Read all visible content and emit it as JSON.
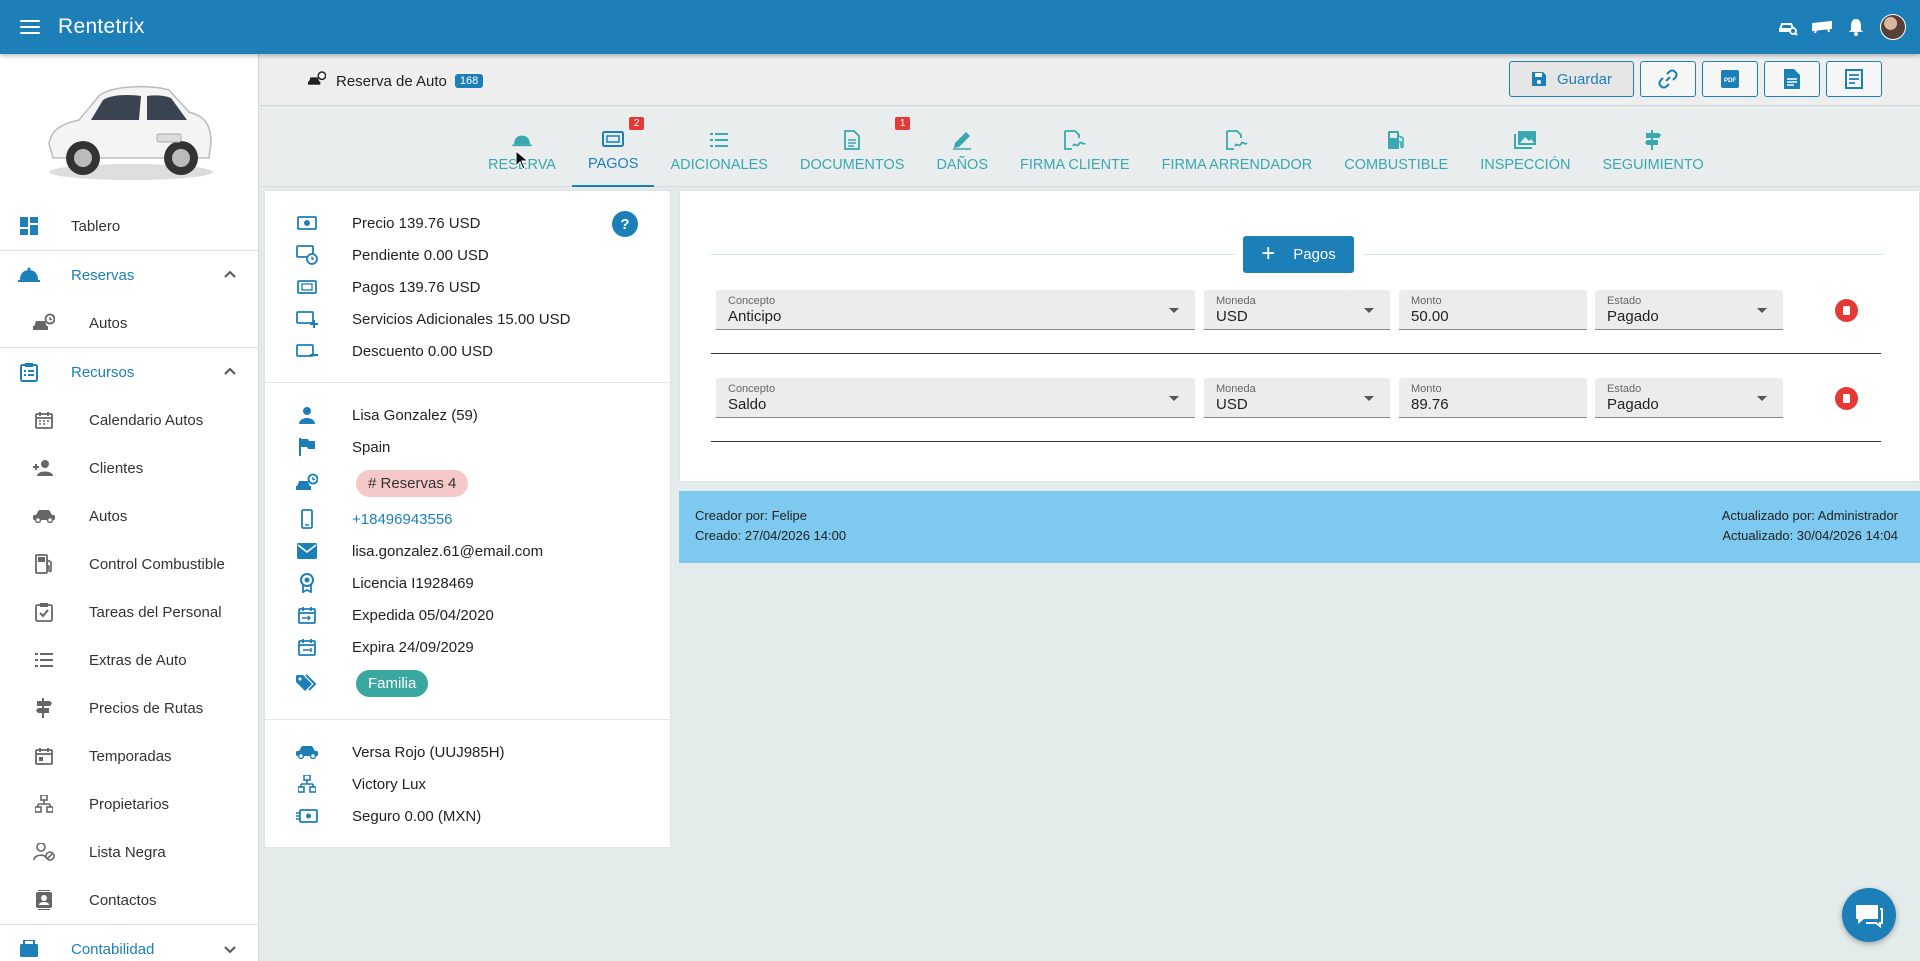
{
  "app": {
    "title": "Rentetrix"
  },
  "colors": {
    "primary": "#1d7fb8",
    "tab": "#3aa8b0",
    "badge": "#e53935",
    "audit_bar": "#7ec9ef",
    "tag_pink": "#f6c9c9",
    "tag_teal": "#3aa8a0"
  },
  "topbar": {
    "icons": [
      "car-search-icon",
      "plane-icon",
      "bell-icon",
      "user-avatar"
    ]
  },
  "sidebar": {
    "items": [
      {
        "label": "Tablero",
        "icon": "dashboard-icon"
      },
      {
        "label": "Reservas",
        "icon": "bell-service-icon",
        "group": true
      },
      {
        "label": "Autos",
        "icon": "car-clock-icon"
      },
      {
        "label": "Recursos",
        "icon": "clipboard-icon",
        "group": true
      },
      {
        "label": "Calendario Autos",
        "icon": "calendar-icon"
      },
      {
        "label": "Clientes",
        "icon": "add-user-icon"
      },
      {
        "label": "Autos",
        "icon": "car-icon"
      },
      {
        "label": "Control Combustible",
        "icon": "fuel-icon"
      },
      {
        "label": "Tareas del Personal",
        "icon": "clipboard-check-icon"
      },
      {
        "label": "Extras de Auto",
        "icon": "list-icon"
      },
      {
        "label": "Precios de Rutas",
        "icon": "signpost-icon"
      },
      {
        "label": "Temporadas",
        "icon": "calendar-icon"
      },
      {
        "label": "Propietarios",
        "icon": "sitemap-icon"
      },
      {
        "label": "Lista Negra",
        "icon": "user-block-icon"
      },
      {
        "label": "Contactos",
        "icon": "contacts-icon"
      },
      {
        "label": "Contabilidad",
        "icon": "accounting-icon",
        "group": true
      }
    ]
  },
  "header": {
    "title": "Reserva de Auto",
    "reservation_number": "168",
    "save_label": "Guardar"
  },
  "tabs": [
    {
      "label": "RESERVA",
      "icon": "bell-service-icon"
    },
    {
      "label": "PAGOS",
      "icon": "money-icon",
      "count": "2",
      "active": true
    },
    {
      "label": "ADICIONALES",
      "icon": "list-icon"
    },
    {
      "label": "DOCUMENTOS",
      "icon": "document-icon",
      "count": "1"
    },
    {
      "label": "DAÑOS",
      "icon": "pencil-icon"
    },
    {
      "label": "FIRMA CLIENTE",
      "icon": "signature-icon"
    },
    {
      "label": "FIRMA ARRENDADOR",
      "icon": "signature-icon"
    },
    {
      "label": "COMBUSTIBLE",
      "icon": "fuel-icon"
    },
    {
      "label": "INSPECCIÓN",
      "icon": "image-multiple-icon"
    },
    {
      "label": "SEGUIMIENTO",
      "icon": "signpost-icon"
    }
  ],
  "summary": {
    "precio": "Precio 139.76 USD",
    "pendiente": "Pendiente 0.00 USD",
    "pagos": "Pagos 139.76 USD",
    "servicios": "Servicios Adicionales 15.00 USD",
    "descuento": "Descuento 0.00 USD"
  },
  "customer": {
    "name": "Lisa Gonzalez (59)",
    "country": "Spain",
    "reservations_tag": "# Reservas 4",
    "phone": "+18496943556",
    "email": "lisa.gonzalez.61@email.com",
    "license": "Licencia I1928469",
    "issued": "Expedida 05/04/2020",
    "expires": "Expira 24/09/2029",
    "tag": "Familia"
  },
  "vehicle": {
    "car": "Versa Rojo (UUJ985H)",
    "owner": "Victory Lux",
    "insurance": "Seguro 0.00 (MXN)"
  },
  "payments": {
    "add_label": "Pagos",
    "labels": {
      "concepto": "Concepto",
      "moneda": "Moneda",
      "monto": "Monto",
      "estado": "Estado"
    },
    "rows": [
      {
        "concepto": "Anticipo",
        "moneda": "USD",
        "monto": "50.00",
        "estado": "Pagado"
      },
      {
        "concepto": "Saldo",
        "moneda": "USD",
        "monto": "89.76",
        "estado": "Pagado"
      }
    ]
  },
  "audit": {
    "created_by": "Creador por: Felipe",
    "created_at": "Creado: 27/04/2026 14:00",
    "updated_by": "Actualizado por: Administrador",
    "updated_at": "Actualizado: 30/04/2026 14:04"
  }
}
